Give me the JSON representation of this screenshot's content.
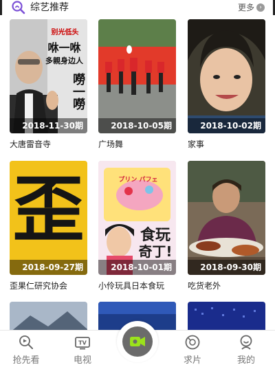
{
  "section": {
    "title": "综艺推荐",
    "more_label": "更多"
  },
  "cards": [
    {
      "episode": "2018-11-30期",
      "title": "大唐雷音寺",
      "poster_text_1": "别光低头",
      "poster_text_2": "咻一咻",
      "poster_text_3": "多親身边人",
      "poster_text_4": "嘮一嘮"
    },
    {
      "episode": "2018-10-05期",
      "title": "广场舞"
    },
    {
      "episode": "2018-10-02期",
      "title": "家事"
    },
    {
      "episode": "2018-09-27期",
      "title": "歪果仁研究协会",
      "poster_text_1": "歪"
    },
    {
      "episode": "2018-10-01期",
      "title": "小伶玩具日本食玩",
      "poster_text_1": "食玩",
      "poster_text_2": "奇丁!",
      "poster_text_3": "プリン パフェ"
    },
    {
      "episode": "2018-09-30期",
      "title": "吃货老外"
    },
    {
      "episode": "",
      "title": ""
    },
    {
      "episode": "",
      "title": ""
    },
    {
      "episode": "",
      "title": ""
    }
  ],
  "tabbar": {
    "tabs": [
      {
        "label": "抢先看",
        "icon": "search-play-icon"
      },
      {
        "label": "电视",
        "icon": "tv-icon"
      },
      {
        "label": "",
        "icon": "camera-record-icon"
      },
      {
        "label": "求片",
        "icon": "request-icon"
      },
      {
        "label": "我的",
        "icon": "profile-icon"
      }
    ]
  },
  "colors": {
    "accent_purple": "#7b4fd6",
    "camera_green": "#9be21b",
    "center_button": "#6b6b6b"
  }
}
